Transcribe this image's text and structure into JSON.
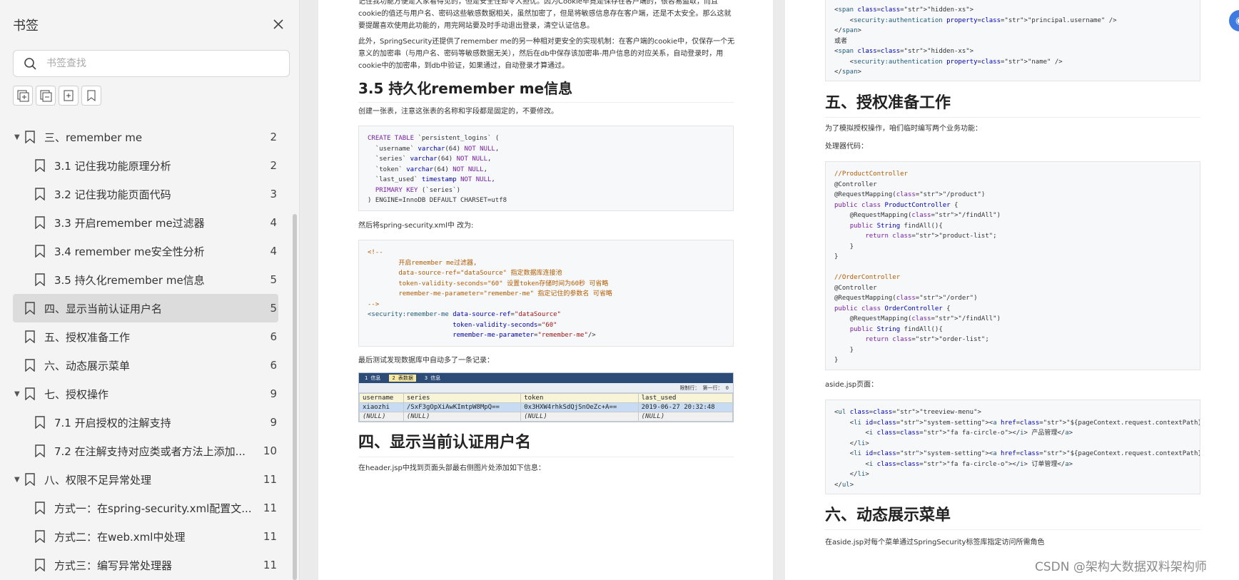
{
  "sidebar": {
    "title": "书签",
    "search_placeholder": "书签查找",
    "items": [
      {
        "label": "三、remember me",
        "page": "2",
        "level": 0,
        "expanded": true
      },
      {
        "label": "3.1 记住我功能原理分析",
        "page": "2",
        "level": 1
      },
      {
        "label": "3.2 记住我功能页面代码",
        "page": "3",
        "level": 1
      },
      {
        "label": "3.3 开启remember me过滤器",
        "page": "4",
        "level": 1
      },
      {
        "label": "3.4 remember me安全性分析",
        "page": "4",
        "level": 1
      },
      {
        "label": "3.5 持久化remember me信息",
        "page": "5",
        "level": 1
      },
      {
        "label": "四、显示当前认证用户名",
        "page": "5",
        "level": 0,
        "selected": true
      },
      {
        "label": "五、授权准备工作",
        "page": "6",
        "level": 0
      },
      {
        "label": "六、动态展示菜单",
        "page": "6",
        "level": 0
      },
      {
        "label": "七、授权操作",
        "page": "9",
        "level": 0,
        "expanded": true
      },
      {
        "label": "7.1 开启授权的注解支持",
        "page": "9",
        "level": 1
      },
      {
        "label": "7.2 在注解支持对应类或者方法上添加...",
        "page": "10",
        "level": 1
      },
      {
        "label": "八、权限不足异常处理",
        "page": "11",
        "level": 0,
        "expanded": true
      },
      {
        "label": "方式一：在spring-security.xml配置文...",
        "page": "11",
        "level": 1
      },
      {
        "label": "方式二：在web.xml中处理",
        "page": "11",
        "level": 1
      },
      {
        "label": "方式三：编写异常处理器",
        "page": "11",
        "level": 1
      }
    ]
  },
  "page1": {
    "intro_1": "记住我功能方便是大家看得见的，但是安全性却令人担忧。因为Cookie毕竟是保存在客户端的，很容易盗取，而且cookie的值还与用户名、密码这些敏感数据相关，虽然加密了，但是将敏感信息存在客户端，还是不太安全。那么这就要提醒喜欢使用此功能的，用完网站要及时手动退出登录，清空认证信息。",
    "intro_2": "此外，SpringSecurity还提供了remember me的另一种相对更安全的实现机制：在客户端的cookie中，仅保存一个无意义的加密串（与用户名、密码等敏感数据无关），然后在db中保存该加密串-用户信息的对应关系，自动登录时，用cookie中的加密串，到db中验证，如果通过，自动登录才算通过。",
    "h_35": "3.5 持久化remember me信息",
    "p_table": "创建一张表，注意这张表的名称和字段都是固定的，不要修改。",
    "sql": [
      "CREATE TABLE `persistent_logins` (",
      "  `username` varchar(64) NOT NULL,",
      "  `series` varchar(64) NOT NULL,",
      "  `token` varchar(64) NOT NULL,",
      "  `last_used` timestamp NOT NULL,",
      "  PRIMARY KEY (`series`)",
      ") ENGINE=InnoDB DEFAULT CHARSET=utf8"
    ],
    "p_xml": "然后将spring-security.xml中 改为:",
    "xml": [
      "<!--",
      "        开启remember me过滤器,",
      "        data-source-ref=\"dataSource\" 指定数据库连接池",
      "        token-validity-seconds=\"60\" 设置token存储时间为60秒 可省略",
      "        remember-me-parameter=\"remember-me\" 指定记住的参数名 可省略",
      "-->",
      "<security:remember-me data-source-ref=\"dataSource\"",
      "                      token-validity-seconds=\"60\"",
      "                      remember-me-parameter=\"remember-me\"/>"
    ],
    "p_db": "最后测试发现数据库中自动多了一条记录：",
    "db": {
      "tabs": [
        "1 信息",
        "2 表数据",
        "3 信息"
      ],
      "toolbar_right": "限制行：  第一行： 0",
      "headers": [
        "username",
        "series",
        "token",
        "last_used"
      ],
      "row": [
        "xiaozhi",
        "/SxF3gOpXiAwKImtpW8MpQ==",
        "0x3HXW4rhkSdQjSnOeZc+A==",
        "2019-06-27 20:32:48"
      ],
      "null_row": [
        "(NULL)",
        "(NULL)",
        "(NULL)",
        "(NULL)"
      ]
    },
    "h_4": "四、显示当前认证用户名",
    "p_header": "在header.jsp中找到页面头部最右侧图片处添加如下信息："
  },
  "page2": {
    "top_code": [
      "<span class=\"hidden-xs\">",
      "    <security:authentication property=\"principal.username\" />",
      "</span>",
      "或者",
      "<span class=\"hidden-xs\">",
      "    <security:authentication property=\"name\" />",
      "</span>"
    ],
    "h_5": "五、授权准备工作",
    "p_5": "为了模拟授权操作，咱们临时编写两个业务功能：",
    "p_ctrl": "处理器代码：",
    "ctrl_code": [
      "//ProductController",
      "@Controller",
      "@RequestMapping(\"/product\")",
      "public class ProductController {",
      "    @RequestMapping(\"/findAll\")",
      "    public String findAll(){",
      "        return \"product-list\";",
      "    }",
      "}",
      "",
      "//OrderController",
      "@Controller",
      "@RequestMapping(\"/order\")",
      "public class OrderController {",
      "    @RequestMapping(\"/findAll\")",
      "    public String findAll(){",
      "        return \"order-list\";",
      "    }",
      "}"
    ],
    "p_aside": "aside.jsp页面：",
    "aside_code": [
      "<ul class=\"treeview-menu\">",
      "    <li id=\"system-setting\"><a href=\"${pageContext.request.contextPath}/product/findAll\">",
      "        <i class=\"fa fa-circle-o\"></i> 产品管理</a>",
      "    </li>",
      "    <li id=\"system-setting\"><a href=\"${pageContext.request.contextPath}/order/findAll\">",
      "        <i class=\"fa fa-circle-o\"></i> 订单管理</a>",
      "    </li>",
      "</ul>"
    ],
    "h_6": "六、动态展示菜单",
    "p_6": "在aside.jsp对每个菜单通过SpringSecurity标签库指定访问所需角色"
  },
  "watermark": "CSDN @架构大数据双料架构师",
  "colors": {
    "sidebar_bg": "#f4f4f4",
    "selected_bg": "#dcdcdc",
    "viewer_bg": "#ebebeb",
    "avatar": "#3d7be0"
  }
}
